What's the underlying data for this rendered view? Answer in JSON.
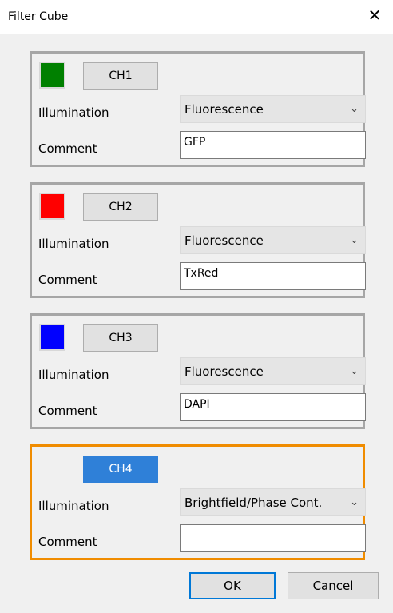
{
  "window": {
    "title": "Filter Cube",
    "close_glyph": "✕"
  },
  "channels": [
    {
      "button_label": "CH1",
      "color": "#008000",
      "illumination_label": "Illumination",
      "illumination_value": "Fluorescence",
      "comment_label": "Comment",
      "comment_value": "GFP",
      "active": false,
      "show_swatch": true
    },
    {
      "button_label": "CH2",
      "color": "#ff0000",
      "illumination_label": "Illumination",
      "illumination_value": "Fluorescence",
      "comment_label": "Comment",
      "comment_value": "TxRed",
      "active": false,
      "show_swatch": true
    },
    {
      "button_label": "CH3",
      "color": "#0000ff",
      "illumination_label": "Illumination",
      "illumination_value": "Fluorescence",
      "comment_label": "Comment",
      "comment_value": "DAPI",
      "active": false,
      "show_swatch": true
    },
    {
      "button_label": "CH4",
      "color": "",
      "illumination_label": "Illumination",
      "illumination_value": "Brightfield/Phase Cont.",
      "comment_label": "Comment",
      "comment_value": "",
      "active": true,
      "show_swatch": false
    }
  ],
  "buttons": {
    "ok_label": "OK",
    "cancel_label": "Cancel"
  },
  "icons": {
    "dropdown": "chevron-down-icon",
    "close": "close-icon"
  },
  "colors": {
    "accent": "#0078d7",
    "active_border": "#f08c00",
    "selected_button": "#2f80d8"
  }
}
